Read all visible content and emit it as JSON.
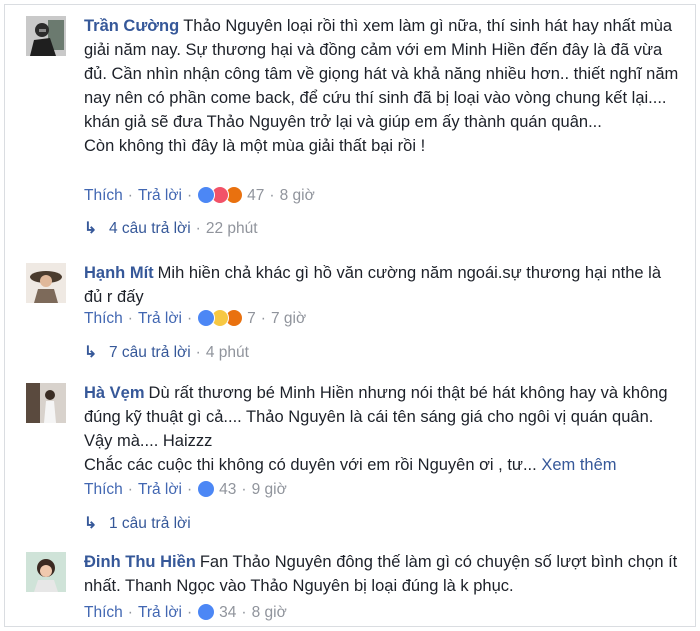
{
  "comments": [
    {
      "author": "Trần Cường",
      "text": "Thảo Nguyên loại rồi thì xem làm gì nữa, thí sinh hát hay nhất mùa giải năm nay. Sự thương hại và đồng cảm với em Minh Hiền đến đây là đã vừa đủ. Cần nhìn nhận công tâm về giọng hát và khả năng nhiều hơn.. thiết nghĩ năm nay nên có phần come back, để cứu thí sinh đã bị loại vào vòng chung kết lại.... khán giả sẽ đưa Thảo Nguyên trở lại và giúp em ấy thành quán quân...",
      "text2": "Còn không thì đây là một mùa giải thất bại rồi !",
      "like_label": "Thích",
      "reply_label": "Trả lời",
      "reaction_count": "47",
      "time": "8 giờ",
      "reactions": [
        "like-icon",
        "love-icon",
        "angry-icon"
      ],
      "replies_text": "4 câu trả lời",
      "replies_time": "22 phút"
    },
    {
      "author": "Hạnh Mít",
      "text": "Mih hiền chả khác gì hồ văn cường năm ngoái.sự thương hại nthe là đủ r đấy",
      "like_label": "Thích",
      "reply_label": "Trả lời",
      "reaction_count": "7",
      "time": "7 giờ",
      "reactions": [
        "like-icon",
        "haha-icon",
        "angry-icon"
      ],
      "replies_text": "7 câu trả lời",
      "replies_time": "4 phút"
    },
    {
      "author": "Hà Vẹm",
      "text": "Dù rất thương bé Minh Hiền nhưng nói thật bé hát không hay và không đúng kỹ thuật gì cả.... Thảo Nguyên là cái tên sáng giá cho ngôi vị quán quân. Vậy mà.... Haizzz",
      "text2": "Chắc các cuộc thi không có duyên với em rồi Nguyên ơi , tư...",
      "see_more": "Xem thêm",
      "like_label": "Thích",
      "reply_label": "Trả lời",
      "reaction_count": "43",
      "time": "9 giờ",
      "reactions": [
        "like-icon"
      ],
      "replies_text": "1 câu trả lời"
    },
    {
      "author": "Đinh Thu Hiền",
      "text": "Fan Thảo Nguyên đông thế làm gì có chuyện số lượt bình chọn ít nhất. Thanh Ngọc vào Thảo Nguyên bị loại đúng là k phục.",
      "like_label": "Thích",
      "reply_label": "Trả lời",
      "reaction_count": "34",
      "time": "8 giờ",
      "reactions": [
        "like-icon"
      ]
    }
  ],
  "colors": {
    "link": "#365899",
    "meta": "#90949c",
    "like": "#4c87f5",
    "love": "#f25268",
    "angry": "#e9710f"
  }
}
